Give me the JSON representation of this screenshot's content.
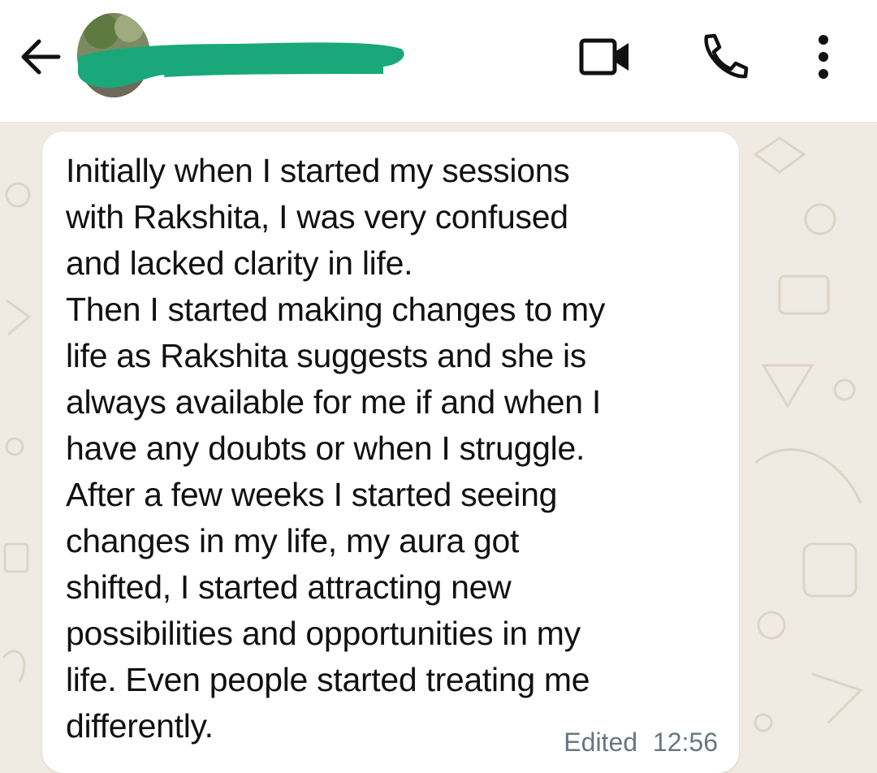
{
  "header": {
    "back_icon": "arrow-left-icon",
    "contact_name_redacted": true,
    "video_call_icon": "video-camera-icon",
    "voice_call_icon": "phone-icon",
    "menu_icon": "more-vert-icon",
    "redaction_color": "#1aa87a"
  },
  "message": {
    "text": "Initially when I started my sessions\nwith Rakshita, I was very confused\nand lacked clarity in life.\nThen I started making changes to my\nlife as Rakshita suggests and she is\nalways available for me if and when I\nhave any doubts or when I struggle.\nAfter a few weeks I started seeing\nchanges in my life, my aura got\nshifted, I started attracting new\npossibilities and opportunities in my\nlife. Even people started treating me\ndifferently.",
    "edited_label": "Edited",
    "time": "12:56"
  },
  "colors": {
    "chat_background": "#efeae2",
    "bubble": "#ffffff",
    "meta_text": "#667781"
  }
}
